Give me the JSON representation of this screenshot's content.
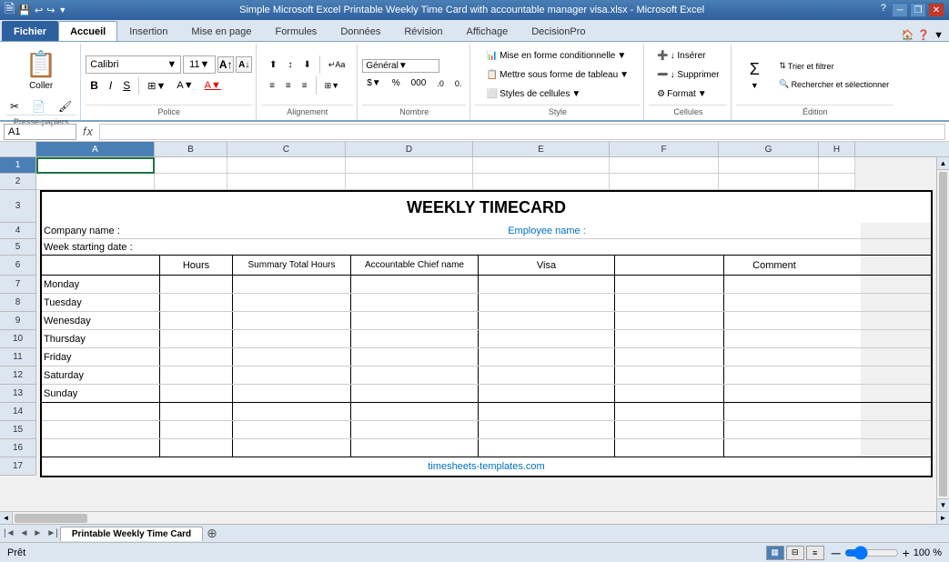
{
  "window": {
    "title": "Simple Microsoft Excel Printable Weekly Time Card with accountable manager visa.xlsx  -  Microsoft Excel",
    "minimize": "─",
    "restore": "❐",
    "close": "✕"
  },
  "ribbon_tabs": {
    "items": [
      {
        "label": "Fichier",
        "active": false
      },
      {
        "label": "Accueil",
        "active": true
      },
      {
        "label": "Insertion",
        "active": false
      },
      {
        "label": "Mise en page",
        "active": false
      },
      {
        "label": "Formules",
        "active": false
      },
      {
        "label": "Données",
        "active": false
      },
      {
        "label": "Révision",
        "active": false
      },
      {
        "label": "Affichage",
        "active": false
      },
      {
        "label": "DecisionPro",
        "active": false
      }
    ]
  },
  "ribbon": {
    "groups": {
      "presse_papiers": "Presse-papiers",
      "police": "Police",
      "alignement": "Alignement",
      "nombre": "Nombre",
      "style": "Style",
      "cellules": "Cellules",
      "edition": "Édition"
    },
    "paste_label": "Coller",
    "font_name": "Calibri",
    "font_size": "11",
    "mise_en_forme": "Mise en forme conditionnelle",
    "tableau": "Mettre sous forme de tableau",
    "styles_cellules": "Styles de cellules",
    "inserer": "↓ Insérer",
    "supprimer": "↓ Supprimer",
    "format": "Format",
    "trier": "Trier et filtrer",
    "rechercher": "Rechercher et sélectionner"
  },
  "formula_bar": {
    "name_box": "A1",
    "formula": ""
  },
  "columns": [
    "A",
    "B",
    "C",
    "D",
    "E",
    "F",
    "G",
    "H"
  ],
  "col_active": "A",
  "rows": [
    1,
    2,
    3,
    4,
    5,
    6,
    7,
    8,
    9,
    10,
    11,
    12,
    13,
    14,
    15,
    16,
    17
  ],
  "row_active": 1,
  "timecard": {
    "title": "WEEKLY TIMECARD",
    "company_label": "Company name :",
    "employee_label": "Employee name :",
    "week_label": "Week starting date :",
    "headers": [
      "Hours",
      "Summary Total Hours",
      "Accountable Chief name",
      "Visa",
      "Comment"
    ],
    "days": [
      "Monday",
      "Tuesday",
      "Wenesday",
      "Thursday",
      "Friday",
      "Saturday",
      "Sunday"
    ],
    "footer": "timesheets-templates.com"
  },
  "sheet_tabs": [
    {
      "label": "Printable Weekly Time Card",
      "active": true
    }
  ],
  "status": {
    "ready": "Prêt",
    "zoom": "100 %"
  }
}
